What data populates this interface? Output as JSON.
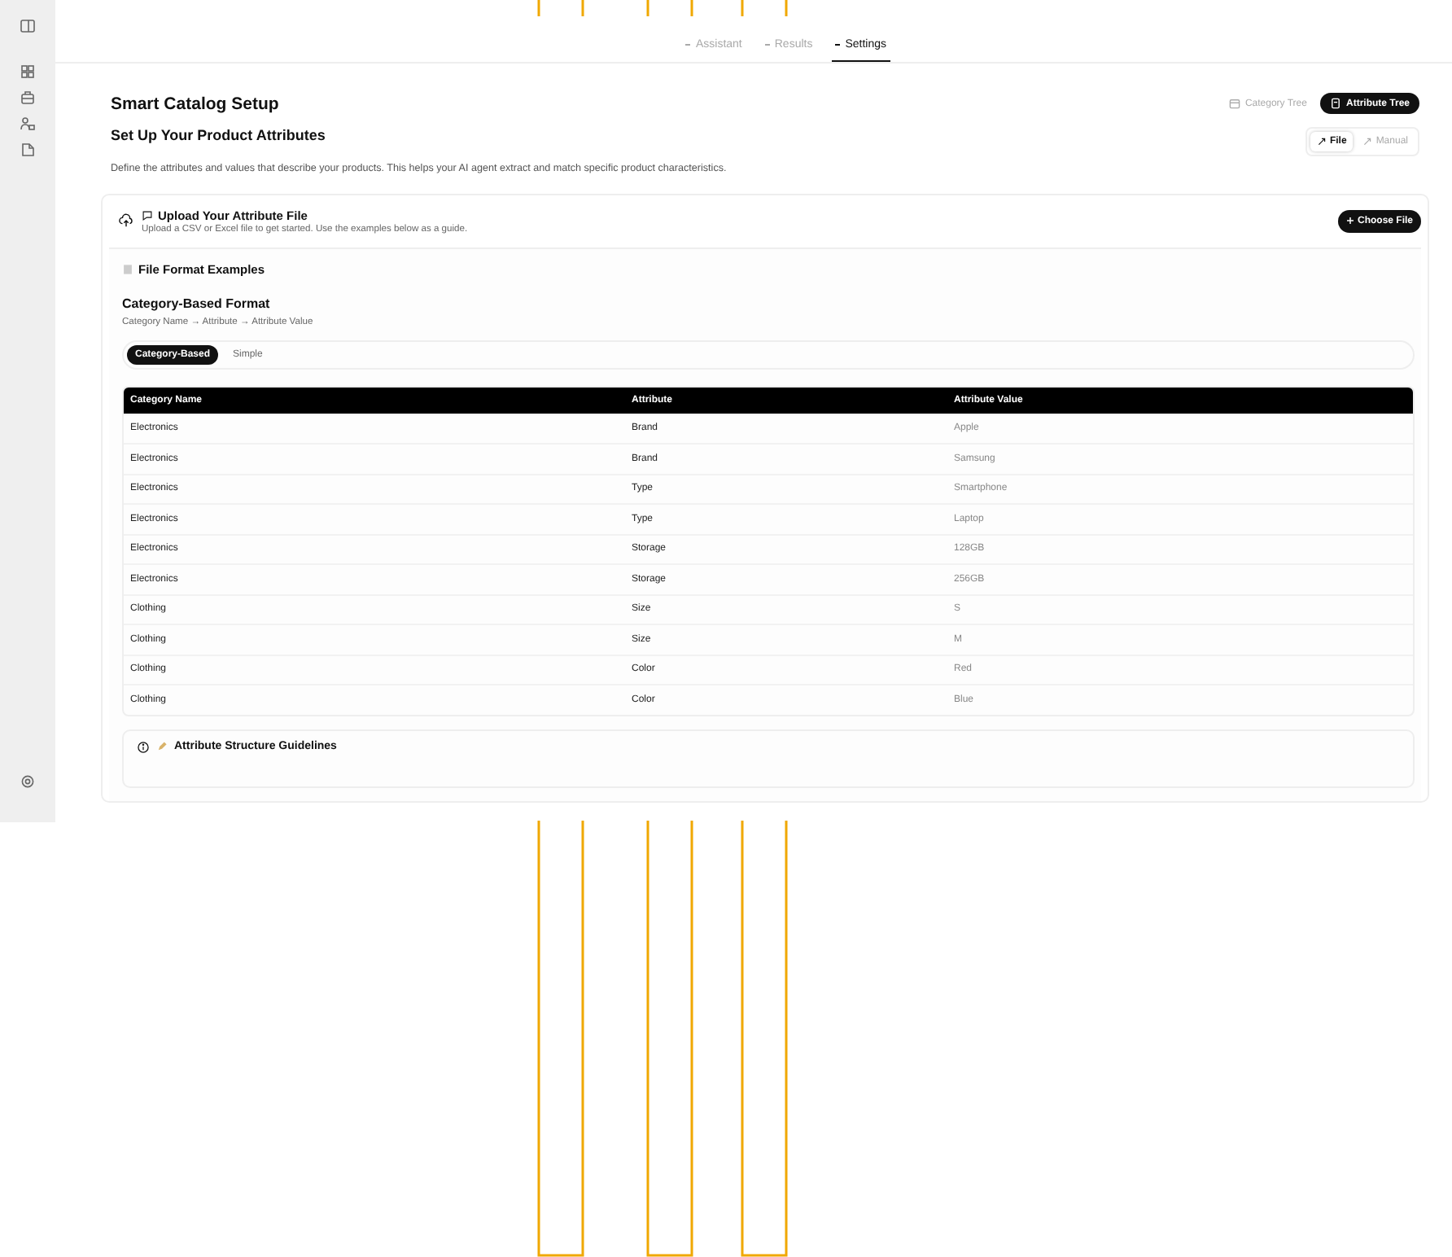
{
  "tabs": [
    {
      "label": "Assistant",
      "selected": false
    },
    {
      "label": "Results",
      "selected": false
    },
    {
      "label": "Settings",
      "selected": true
    }
  ],
  "page": {
    "title": "Smart Catalog Setup",
    "view_toggle": [
      {
        "label": "Category Tree",
        "selected": false
      },
      {
        "label": "Attribute Tree",
        "selected": true
      }
    ]
  },
  "section": {
    "heading": "Set Up Your Product Attributes",
    "description": "Define the attributes and values that describe your products. This helps your AI agent extract and match specific product characteristics.",
    "source_toggle": [
      {
        "label": "File",
        "selected": true
      },
      {
        "label": "Manual",
        "selected": false
      }
    ]
  },
  "upload": {
    "title": "Upload Your Attribute File",
    "hint": "Upload a CSV or Excel file to get started. Use the examples below as a guide.",
    "button": "Choose File"
  },
  "examples": {
    "title": "File Format Examples",
    "format_title": "Category-Based Format",
    "format_path": "Category Name → Attribute → Attribute Value",
    "format_tabs": [
      {
        "label": "Category-Based",
        "selected": true
      },
      {
        "label": "Simple",
        "selected": false
      }
    ],
    "table": {
      "columns": [
        "Category Name",
        "Attribute",
        "Attribute Value"
      ],
      "rows": [
        [
          "Electronics",
          "Brand",
          "Apple"
        ],
        [
          "Electronics",
          "Brand",
          "Samsung"
        ],
        [
          "Electronics",
          "Type",
          "Smartphone"
        ],
        [
          "Electronics",
          "Type",
          "Laptop"
        ],
        [
          "Electronics",
          "Storage",
          "128GB"
        ],
        [
          "Electronics",
          "Storage",
          "256GB"
        ],
        [
          "Clothing",
          "Size",
          "S"
        ],
        [
          "Clothing",
          "Size",
          "M"
        ],
        [
          "Clothing",
          "Color",
          "Red"
        ],
        [
          "Clothing",
          "Color",
          "Blue"
        ]
      ]
    }
  },
  "guidelines": {
    "title": "Attribute Structure Guidelines"
  }
}
